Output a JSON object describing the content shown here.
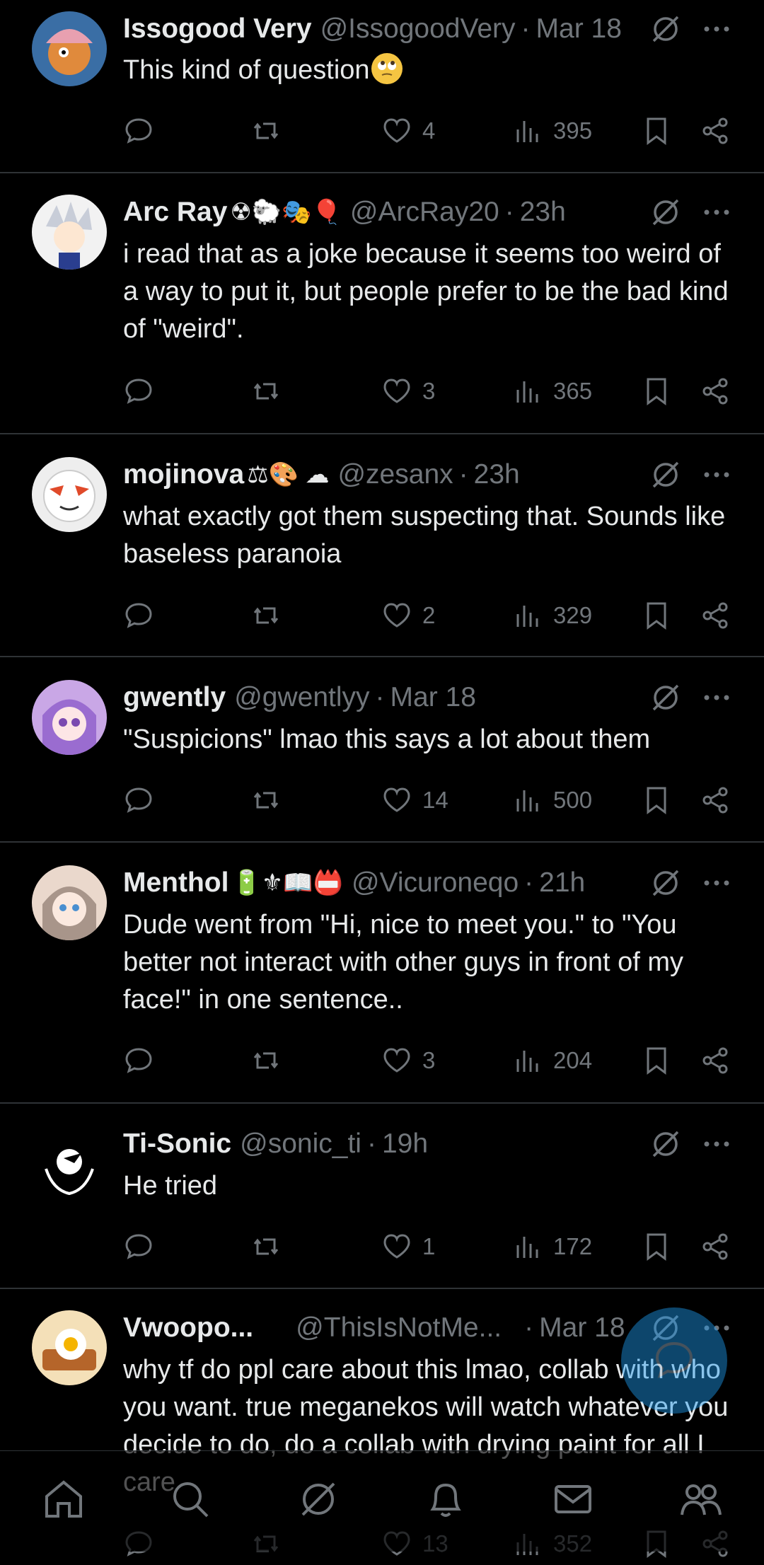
{
  "tweets": [
    {
      "name": "Issogood Very",
      "emojis": "",
      "handle": "@IssogoodVery",
      "time": "Mar 18",
      "text": "This kind of question",
      "trailing_emoji": "face-with-rolling-eyes",
      "replies": "",
      "reposts": "",
      "likes": "4",
      "views": "395"
    },
    {
      "name": "Arc Ray",
      "emojis": "☢🐑🎭🎈",
      "handle": "@ArcRay20",
      "time": "23h",
      "text": "i read that as a joke because it seems too weird of a way to put it, but people prefer to be the bad kind of \"weird\".",
      "likes": "3",
      "views": "365"
    },
    {
      "name": "mojinova",
      "emojis": "⚖🎨 ☁",
      "handle": "@zesanx",
      "time": "23h",
      "text": "what exactly got them suspecting that. Sounds like baseless paranoia",
      "likes": "2",
      "views": "329"
    },
    {
      "name": "gwently",
      "emojis": "",
      "handle": "@gwentlyy",
      "time": "Mar 18",
      "text": "\"Suspicions\" lmao this says a lot about them",
      "likes": "14",
      "views": "500"
    },
    {
      "name": "Menthol",
      "emojis": "🔋⚜📖📛",
      "handle": "@Vicuroneqo",
      "time": "21h",
      "text": "Dude went from \"Hi, nice to meet you.\" to \"You better not interact with other guys in front of my face!\" in one sentence..",
      "likes": "3",
      "views": "204"
    },
    {
      "name": "Ti-Sonic",
      "emojis": "",
      "handle": "@sonic_ti",
      "time": "19h",
      "text": "He tried",
      "likes": "1",
      "views": "172"
    },
    {
      "name": "Vwoopo...",
      "emojis": "",
      "handle": "@ThisIsNotMe...",
      "time": "Mar 18",
      "text": "why tf do ppl care about this lmao, collab with who you want. true meganekos will watch whatever you decide to do, do a collab with drying paint for all I care",
      "likes": "13",
      "views": "352"
    }
  ],
  "colors": {
    "background": "#000000",
    "text": "#e7e9ea",
    "secondary": "#71767b",
    "divider": "#2f3336",
    "accent": "#1d9bf0"
  },
  "icons": [
    "reply-icon",
    "repost-icon",
    "like-icon",
    "views-icon",
    "bookmark-icon",
    "share-icon",
    "grok-icon",
    "more-icon"
  ],
  "nav": [
    "home-icon",
    "search-icon",
    "grok-icon",
    "notifications-icon",
    "messages-icon",
    "communities-icon"
  ]
}
